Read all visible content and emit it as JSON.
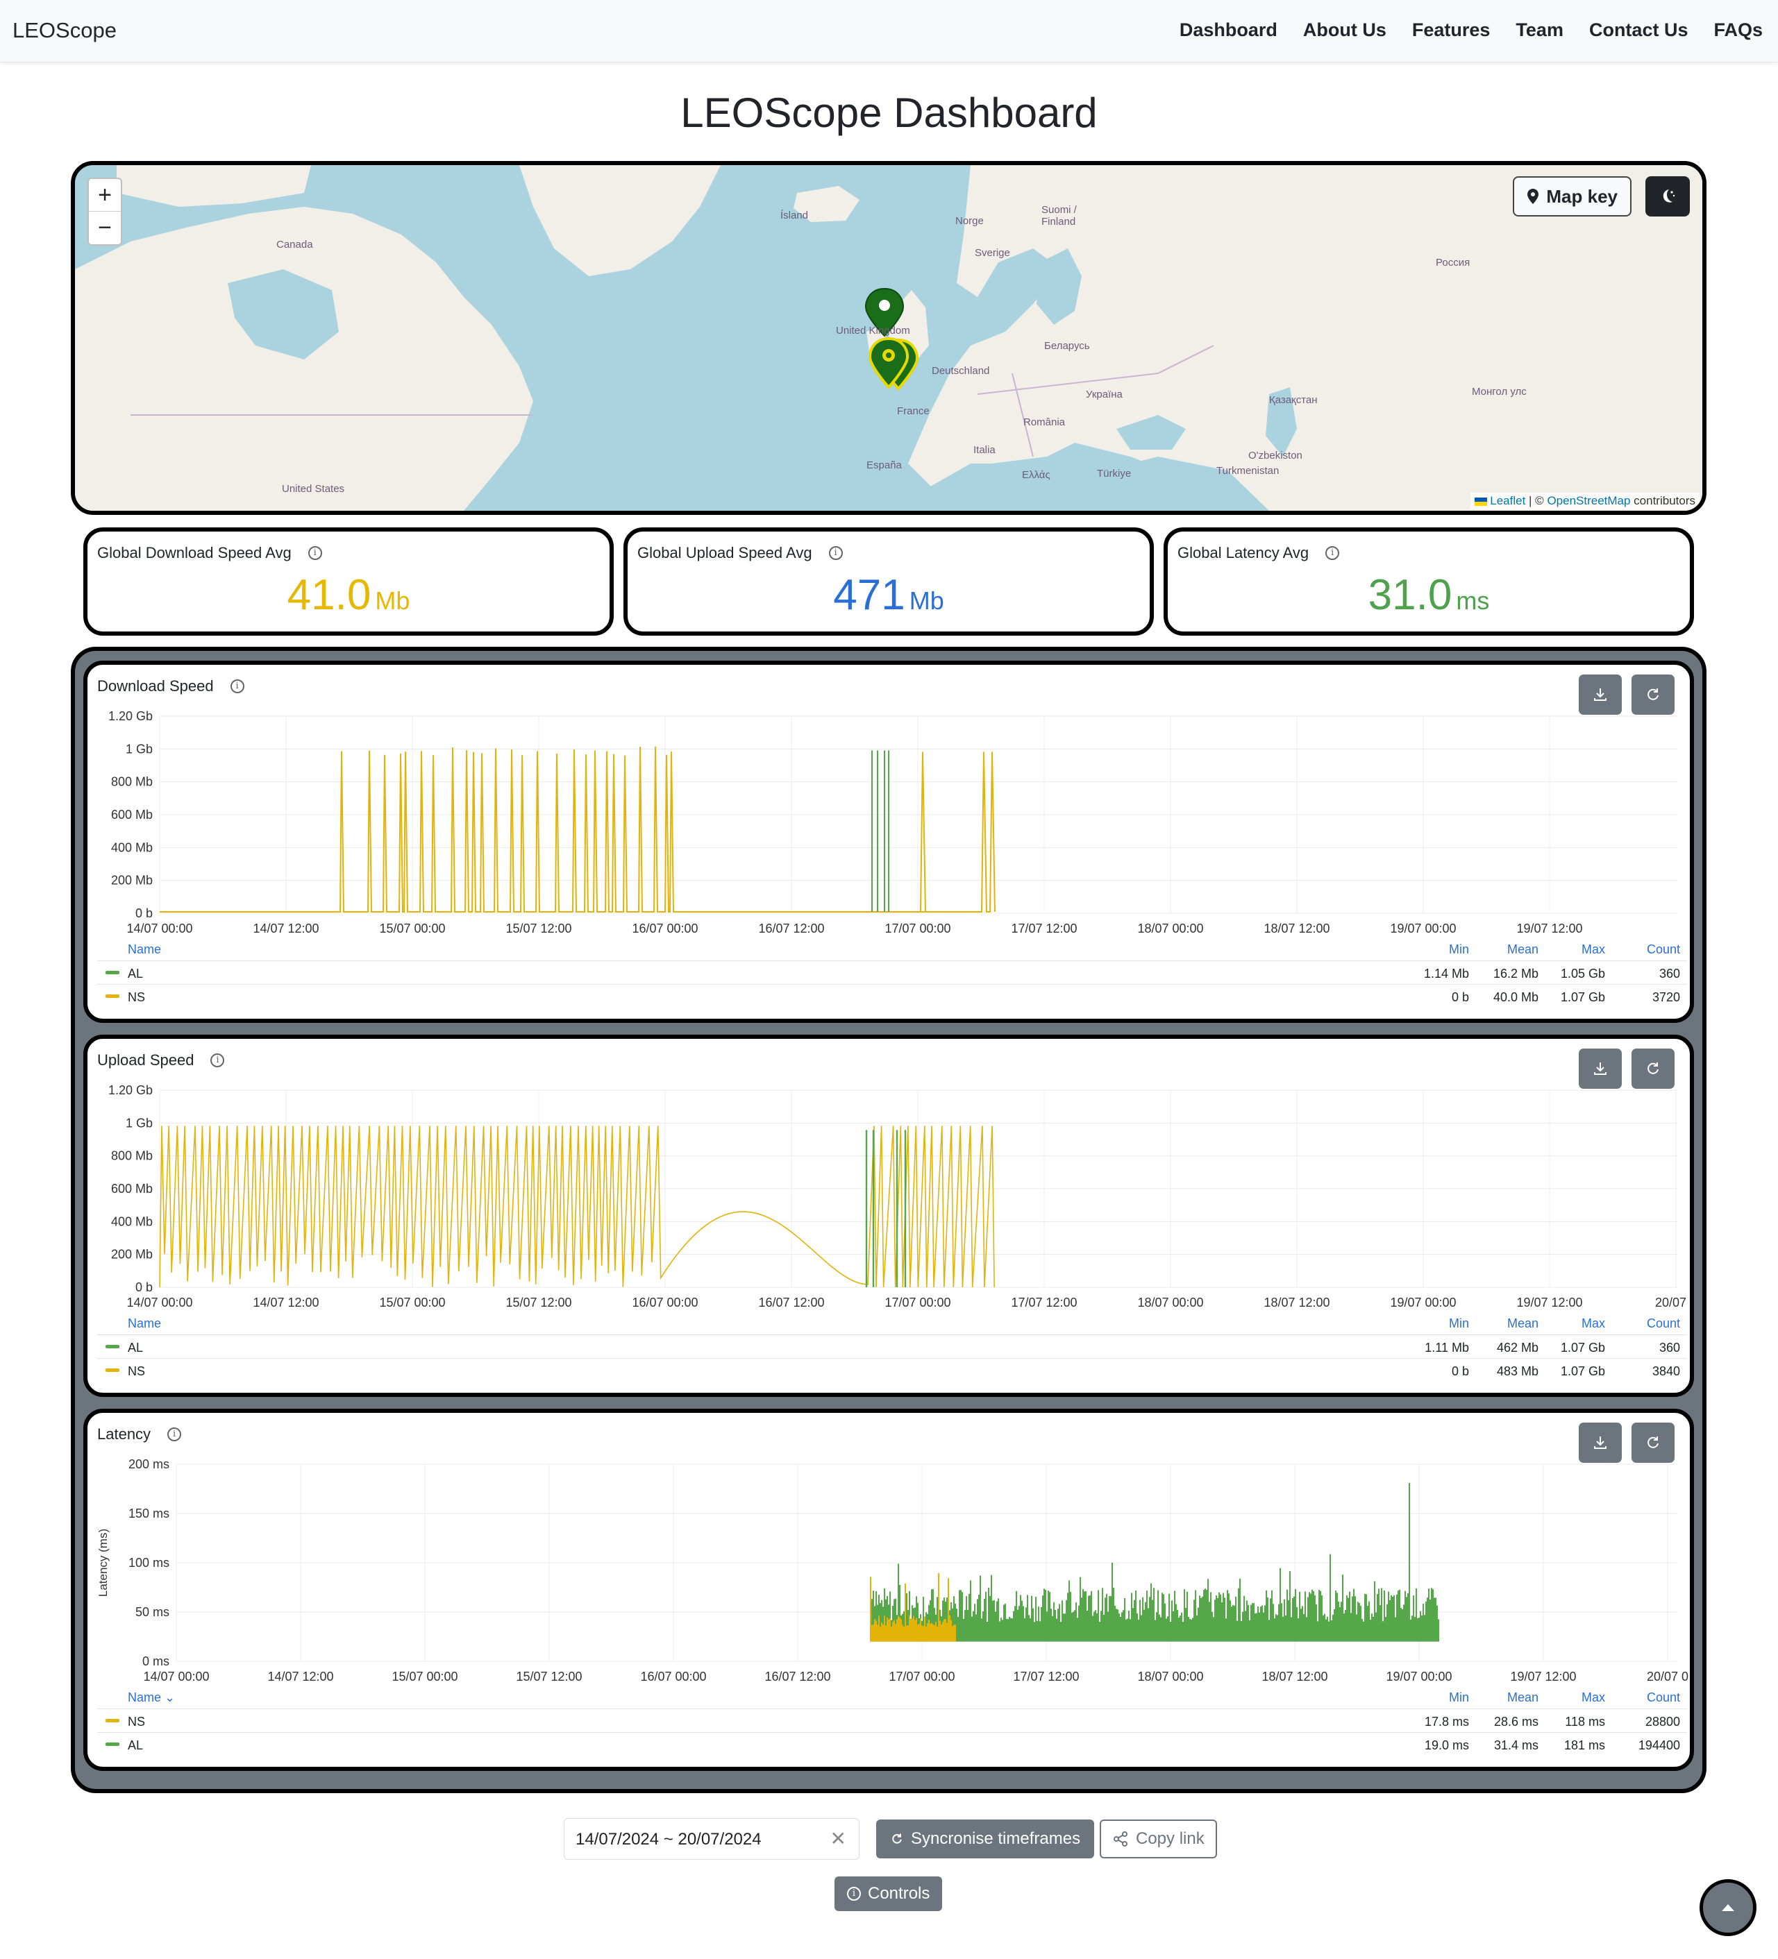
{
  "navbar": {
    "brand": "LEOScope",
    "links": [
      "Dashboard",
      "About Us",
      "Features",
      "Team",
      "Contact Us",
      "FAQs"
    ]
  },
  "page_title": "LEOScope Dashboard",
  "map": {
    "zoom_in": "+",
    "zoom_out": "−",
    "map_key_label": "Map key",
    "attribution_leaflet": "Leaflet",
    "attribution_sep": " | © ",
    "attribution_osm": "OpenStreetMap",
    "attribution_rest": " contributors",
    "labels": [
      "Ísland",
      "Norge",
      "Sverige",
      "Suomi / Finland",
      "Canada",
      "United Kingdom",
      "Deutschland",
      "Беларусь",
      "Россия",
      "France",
      "Україна",
      "România",
      "Italia",
      "España",
      "Ελλάς",
      "Türkiye",
      "Қазақстан",
      "O'zbekiston",
      "Turkmenistan",
      "Монгол улс",
      "United States"
    ],
    "colors": {
      "water": "#aad3df",
      "land": "#f2efe9",
      "marker_dark": "#1a6e1a",
      "marker_yellow": "#e6d800"
    }
  },
  "stats": [
    {
      "title": "Global Download Speed Avg",
      "value": "41.0",
      "unit": "Mb",
      "color": "#e6b800"
    },
    {
      "title": "Global Upload Speed Avg",
      "value": "471",
      "unit": "Mb",
      "color": "#2b6fd6"
    },
    {
      "title": "Global Latency Avg",
      "value": "31.0",
      "unit": "ms",
      "color": "#4ea24e"
    }
  ],
  "legend_headers": {
    "name": "Name",
    "name_sorted": "Name ⌄",
    "min": "Min",
    "mean": "Mean",
    "max": "Max",
    "count": "Count"
  },
  "series_colors": {
    "AL": "#56a74a",
    "NS": "#e3b30a"
  },
  "charts": {
    "download": {
      "title": "Download Speed",
      "y_ticks": [
        "1.20 Gb",
        "1 Gb",
        "800 Mb",
        "600 Mb",
        "400 Mb",
        "200 Mb",
        "0 b"
      ],
      "x_ticks": [
        "14/07 00:00",
        "14/07 12:00",
        "15/07 00:00",
        "15/07 12:00",
        "16/07 00:00",
        "16/07 12:00",
        "17/07 00:00",
        "17/07 12:00",
        "18/07 00:00",
        "18/07 12:00",
        "19/07 00:00",
        "19/07 12:00"
      ],
      "rows": [
        {
          "name": "AL",
          "min": "1.14 Mb",
          "mean": "16.2 Mb",
          "max": "1.05 Gb",
          "count": "360"
        },
        {
          "name": "NS",
          "min": "0 b",
          "mean": "40.0 Mb",
          "max": "1.07 Gb",
          "count": "3720"
        }
      ]
    },
    "upload": {
      "title": "Upload Speed",
      "y_ticks": [
        "1.20 Gb",
        "1 Gb",
        "800 Mb",
        "600 Mb",
        "400 Mb",
        "200 Mb",
        "0 b"
      ],
      "x_ticks": [
        "14/07 00:00",
        "14/07 12:00",
        "15/07 00:00",
        "15/07 12:00",
        "16/07 00:00",
        "16/07 12:00",
        "17/07 00:00",
        "17/07 12:00",
        "18/07 00:00",
        "18/07 12:00",
        "19/07 00:00",
        "19/07 12:00",
        "20/07 0"
      ],
      "rows": [
        {
          "name": "AL",
          "min": "1.11 Mb",
          "mean": "462 Mb",
          "max": "1.07 Gb",
          "count": "360"
        },
        {
          "name": "NS",
          "min": "0 b",
          "mean": "483 Mb",
          "max": "1.07 Gb",
          "count": "3840"
        }
      ]
    },
    "latency": {
      "title": "Latency",
      "y_axis_label": "Latency (ms)",
      "y_ticks": [
        "200 ms",
        "150 ms",
        "100 ms",
        "50 ms",
        "0 ms"
      ],
      "x_ticks": [
        "14/07 00:00",
        "14/07 12:00",
        "15/07 00:00",
        "15/07 12:00",
        "16/07 00:00",
        "16/07 12:00",
        "17/07 00:00",
        "17/07 12:00",
        "18/07 00:00",
        "18/07 12:00",
        "19/07 00:00",
        "19/07 12:00",
        "20/07 0"
      ],
      "rows": [
        {
          "name": "NS",
          "min": "17.8 ms",
          "mean": "28.6 ms",
          "max": "118 ms",
          "count": "28800"
        },
        {
          "name": "AL",
          "min": "19.0 ms",
          "mean": "31.4 ms",
          "max": "181 ms",
          "count": "194400"
        }
      ]
    }
  },
  "controls": {
    "date_range": "14/07/2024 ~ 20/07/2024",
    "clear_symbol": "✕",
    "sync_label": "Syncronise timeframes",
    "copy_label": "Copy link",
    "controls_label": "Controls"
  }
}
